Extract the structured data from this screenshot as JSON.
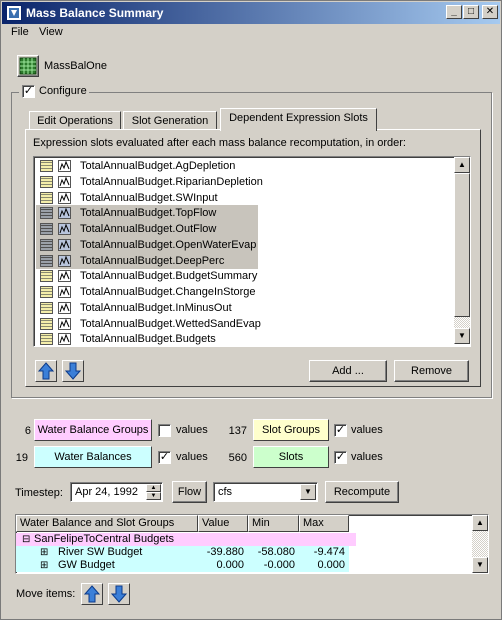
{
  "window": {
    "title": "Mass Balance Summary",
    "controls": [
      "_",
      "□",
      "✕"
    ]
  },
  "menu": {
    "items": [
      "File",
      "View"
    ]
  },
  "massbal": {
    "name": "MassBalOne"
  },
  "configure": {
    "label": "Configure",
    "checked": true
  },
  "tabs": [
    {
      "label": "Edit Operations"
    },
    {
      "label": "Slot Generation"
    },
    {
      "label": "Dependent Expression Slots"
    }
  ],
  "panel": {
    "description": "Expression slots evaluated after each mass balance recomputation, in order:",
    "slots": [
      {
        "label": "TotalAnnualBudget.AgDepletion",
        "selected": false
      },
      {
        "label": "TotalAnnualBudget.RiparianDepletion",
        "selected": false
      },
      {
        "label": "TotalAnnualBudget.SWInput",
        "selected": false
      },
      {
        "label": "TotalAnnualBudget.TopFlow",
        "selected": true
      },
      {
        "label": "TotalAnnualBudget.OutFlow",
        "selected": true
      },
      {
        "label": "TotalAnnualBudget.OpenWaterEvap",
        "selected": true
      },
      {
        "label": "TotalAnnualBudget.DeepPerc",
        "selected": true
      },
      {
        "label": "TotalAnnualBudget.BudgetSummary",
        "selected": false
      },
      {
        "label": "TotalAnnualBudget.ChangeInStorge",
        "selected": false
      },
      {
        "label": "TotalAnnualBudget.InMinusOut",
        "selected": false
      },
      {
        "label": "TotalAnnualBudget.WettedSandEvap",
        "selected": false
      },
      {
        "label": "TotalAnnualBudget.Budgets",
        "selected": false
      }
    ],
    "add_label": "Add ...",
    "remove_label": "Remove"
  },
  "summary": {
    "wbg_count": "6",
    "wbg_label": "Water Balance Groups",
    "wbg_values_label": "values",
    "wbg_values_checked": false,
    "sg_count": "137",
    "sg_label": "Slot Groups",
    "sg_values_label": "values",
    "sg_values_checked": true,
    "wb_count": "19",
    "wb_label": "Water Balances",
    "wb_values_label": "values",
    "wb_values_checked": true,
    "slots_count": "560",
    "slots_label": "Slots",
    "slots_values_label": "values",
    "slots_values_checked": true
  },
  "timestep": {
    "label": "Timestep:",
    "value": "Apr 24, 1992",
    "flow_label": "Flow",
    "units": "cfs",
    "recompute_label": "Recompute"
  },
  "table": {
    "columns": [
      "Water Balance and Slot Groups",
      "Value",
      "Min",
      "Max"
    ],
    "rows": [
      {
        "name": "SanFelipeToCentral Budgets",
        "value": "",
        "min": "",
        "max": "",
        "level": 0,
        "expander": "⊟"
      },
      {
        "name": "River SW Budget",
        "value": "-39.880",
        "min": "-58.080",
        "max": "-9.474",
        "level": 1,
        "expander": "⊞"
      },
      {
        "name": "GW Budget",
        "value": "0.000",
        "min": "-0.000",
        "max": "0.000",
        "level": 1,
        "expander": "⊞"
      }
    ]
  },
  "move": {
    "label": "Move items:"
  },
  "colors": {
    "wbg": "#ffccff",
    "sg": "#ffffcc",
    "wb": "#ccffff",
    "slots": "#ccffcc",
    "arrow": "#3b7fd8"
  }
}
